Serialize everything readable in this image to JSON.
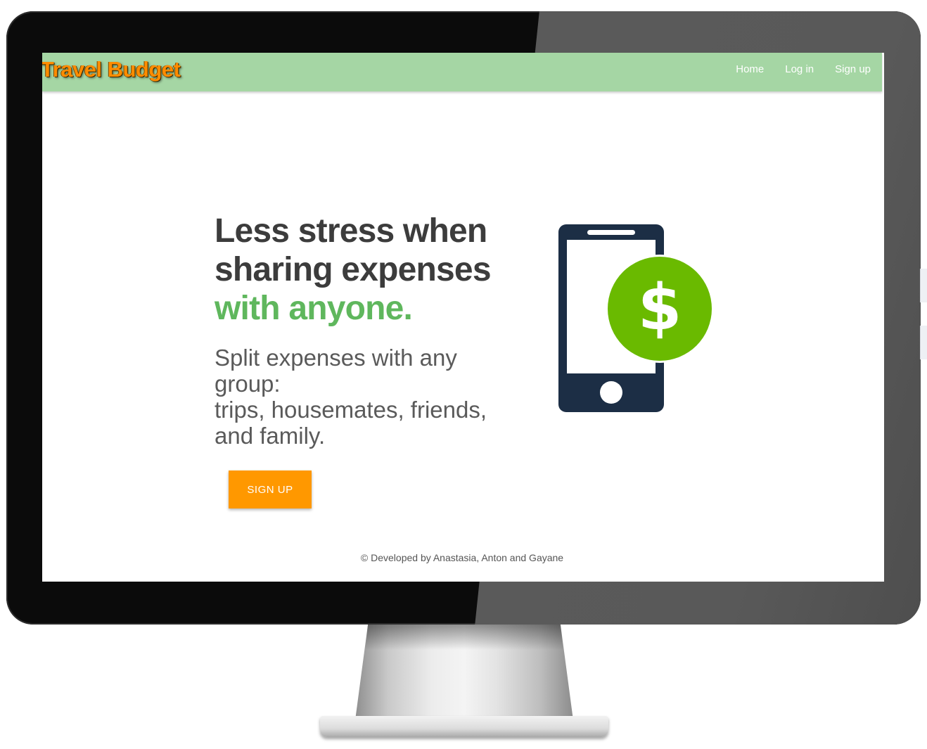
{
  "brand": {
    "title": "Travel Budget"
  },
  "nav": {
    "items": [
      {
        "label": "Home"
      },
      {
        "label": "Log in"
      },
      {
        "label": "Sign up"
      }
    ]
  },
  "hero": {
    "headline_line1": "Less stress when",
    "headline_line2": "sharing expenses",
    "headline_accent": "with anyone.",
    "subhead_line1": "Split expenses with any",
    "subhead_line2": "group:",
    "subhead_line3": "trips, housemates, friends,",
    "subhead_line4": "and family.",
    "cta_label": "SIGN UP"
  },
  "illustration": {
    "icon": "phone-dollar-icon",
    "dollar_glyph": "$"
  },
  "footer": {
    "text": "© Developed by Anastasia, Anton and Gayane"
  },
  "colors": {
    "navbar": "#a5d6a4",
    "brand": "#ff8c00",
    "accent_green": "#5fb75d",
    "cta": "#ff9800",
    "phone": "#1c2e45",
    "dollar_circle": "#6aba00"
  }
}
